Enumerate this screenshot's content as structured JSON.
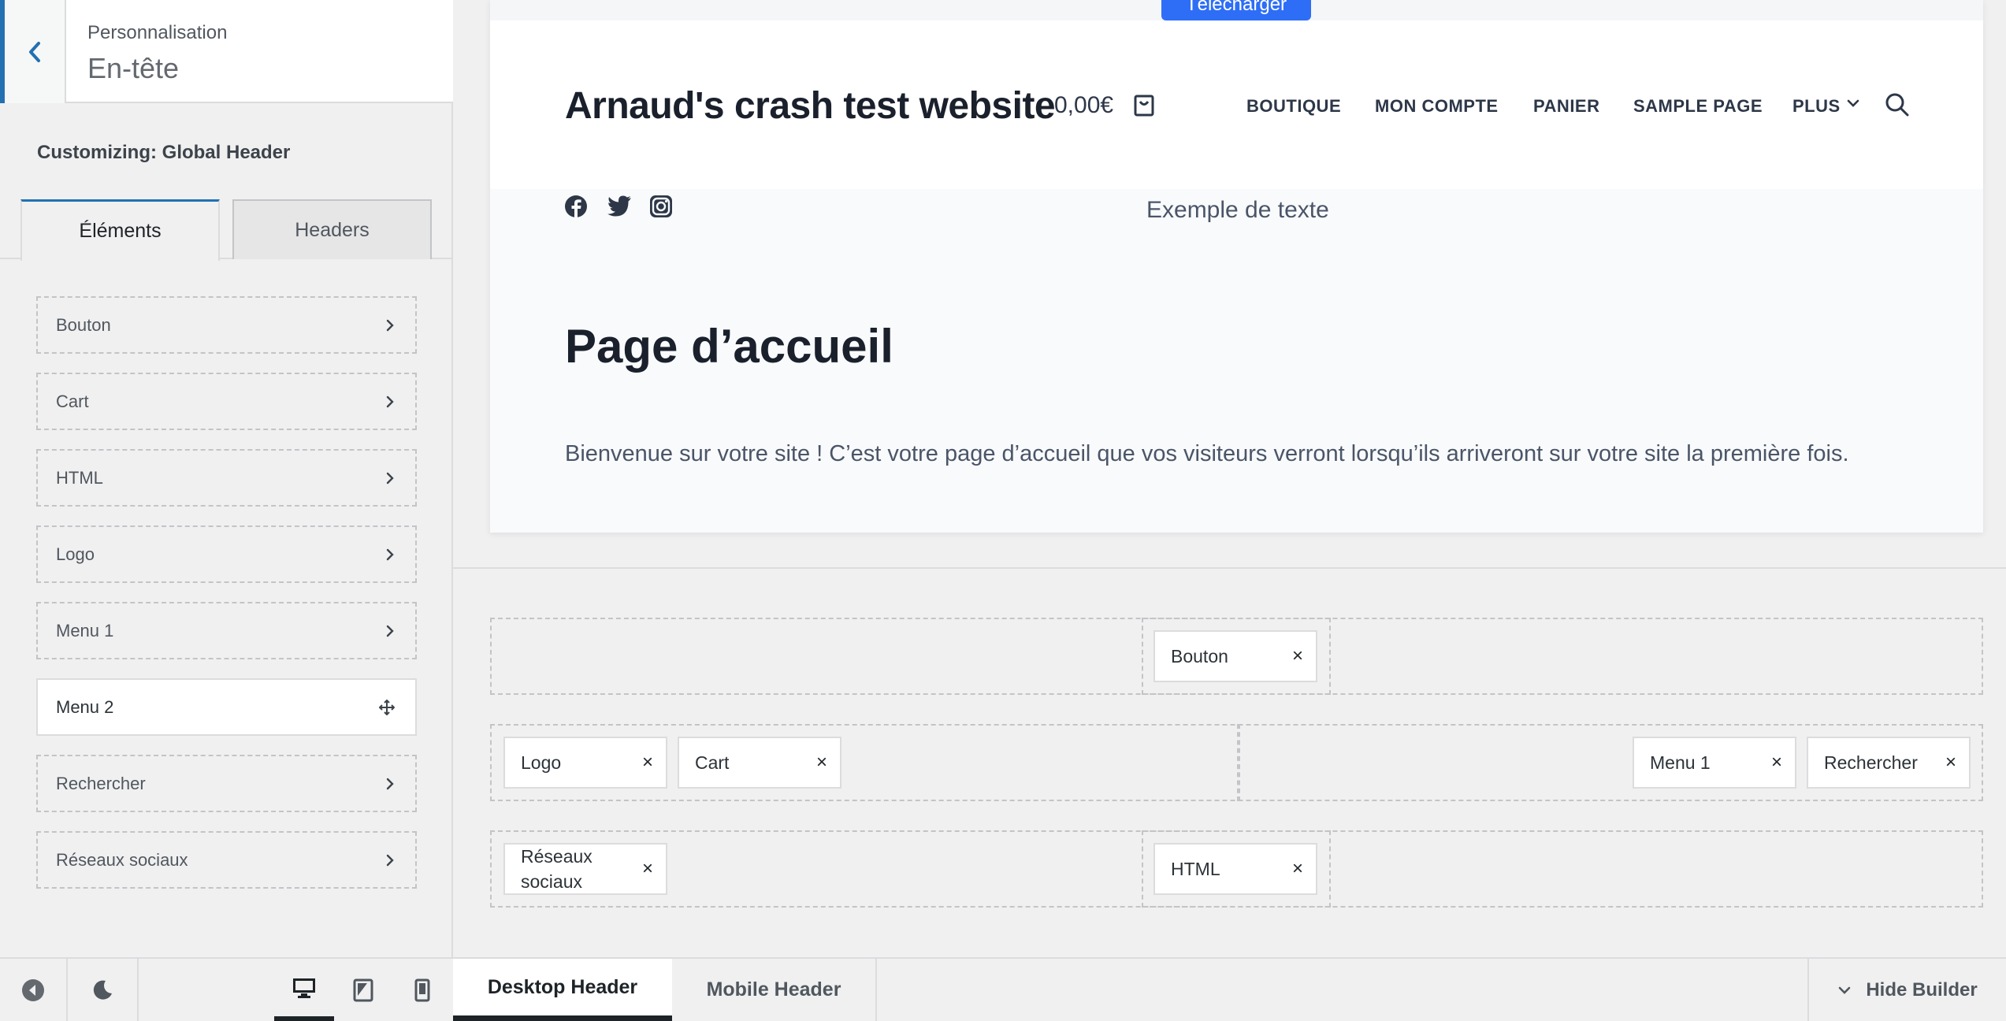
{
  "sidebar": {
    "breadcrumb": "Personnalisation",
    "title": "En-tête",
    "customizing": "Customizing: Global Header",
    "tabs": [
      "Éléments",
      "Headers"
    ],
    "items": [
      "Bouton",
      "Cart",
      "HTML",
      "Logo",
      "Menu 1",
      "Menu 2",
      "Rechercher",
      "Réseaux sociaux"
    ]
  },
  "preview": {
    "download_button": "Télécharger",
    "site_title": "Arnaud's crash test website",
    "cart_total": "0,00€",
    "nav": [
      "BOUTIQUE",
      "MON COMPTE",
      "PANIER",
      "SAMPLE PAGE",
      "PLUS"
    ],
    "sample_text": "Exemple de texte",
    "page_heading": "Page d’accueil",
    "page_body": "Bienvenue sur votre site ! C’est votre page d’accueil que vos visiteurs verront lorsqu’ils arriveront sur votre site la première fois."
  },
  "builder": {
    "row1": {
      "center": [
        "Bouton"
      ]
    },
    "row2": {
      "left": [
        "Logo",
        "Cart"
      ],
      "right": [
        "Menu 1",
        "Rechercher"
      ]
    },
    "row3": {
      "left_line1": "Réseaux",
      "left_line2": "sociaux",
      "center": [
        "HTML"
      ]
    },
    "remove_glyph": "×"
  },
  "bottom_bar": {
    "tabs": [
      "Desktop Header",
      "Mobile Header"
    ],
    "hide_builder": "Hide Builder"
  },
  "colors": {
    "accent": "#2271b1",
    "download": "#2e6ef6"
  }
}
